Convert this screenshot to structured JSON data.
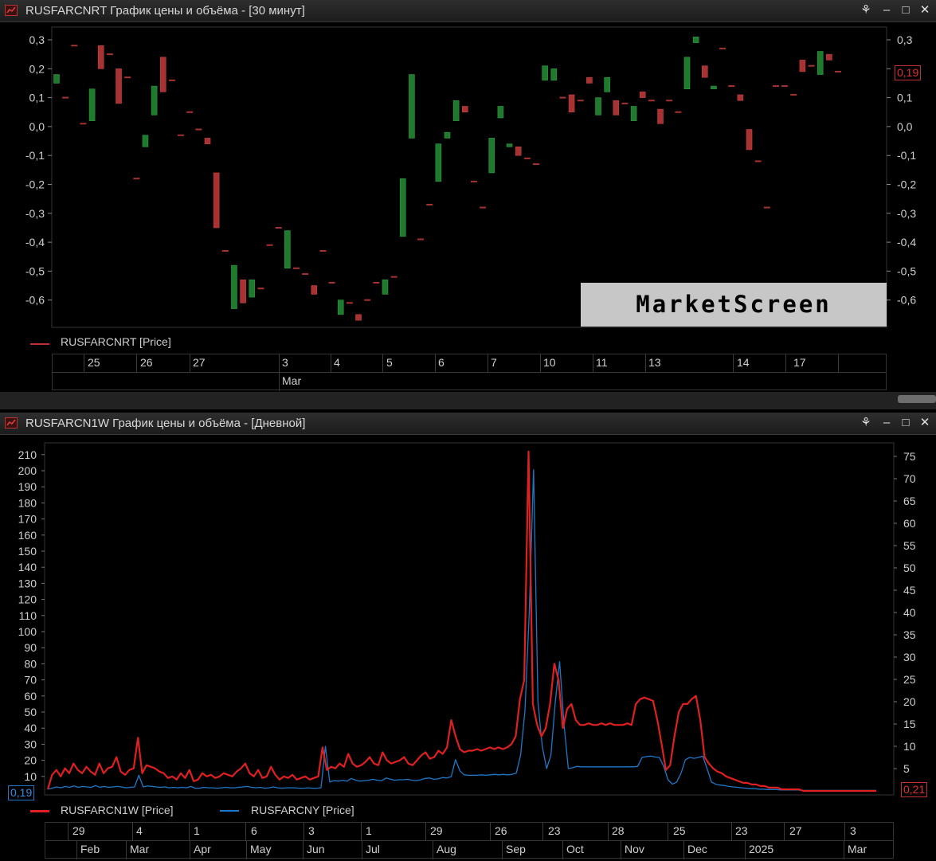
{
  "top_window": {
    "title": "RUSFARCNRT График цены и объёма - [30 минут]",
    "legend": "RUSFARCNRT [Price]",
    "last_value": "0,19",
    "y_ticks": [
      "0,3",
      "0,2",
      "0,1",
      "0,0",
      "-0,1",
      "-0,2",
      "-0,3",
      "-0,4",
      "-0,5",
      "-0,6"
    ],
    "day_labels": [
      "25",
      "26",
      "27",
      "3",
      "4",
      "5",
      "6",
      "7",
      "10",
      "11",
      "13",
      "14",
      "17"
    ],
    "month_labels": [
      "Mar"
    ],
    "watermark": "MarketScreen"
  },
  "bottom_window": {
    "title": "RUSFARCN1W График цены и объёма - [Дневной]",
    "legend_1": "RUSFARCN1W [Price]",
    "legend_2": "RUSFARCNY [Price]",
    "left_value": "0,19",
    "right_value": "0,21",
    "y_ticks_left": [
      "210",
      "200",
      "190",
      "180",
      "170",
      "160",
      "150",
      "140",
      "130",
      "120",
      "110",
      "100",
      "90",
      "80",
      "70",
      "60",
      "50",
      "40",
      "30",
      "20",
      "10"
    ],
    "y_ticks_right": [
      "75",
      "70",
      "65",
      "60",
      "55",
      "50",
      "45",
      "40",
      "35",
      "30",
      "25",
      "20",
      "15",
      "10",
      "5"
    ],
    "day_labels": [
      "29",
      "4",
      "1",
      "6",
      "3",
      "1",
      "29",
      "26",
      "23",
      "28",
      "25",
      "23",
      "27",
      "3"
    ],
    "month_labels": [
      "Feb",
      "Mar",
      "Apr",
      "May",
      "Jun",
      "Jul",
      "Aug",
      "Sep",
      "Oct",
      "Nov",
      "Dec",
      "2025",
      "Mar"
    ]
  },
  "colors": {
    "up": "#1f7a2e",
    "down": "#a83232",
    "red_line": "#e02020",
    "blue_line": "#1e78c8",
    "axis": "#cfcfcf"
  },
  "icons": [
    "chart-app-icon",
    "pin-icon",
    "minimize-icon",
    "maximize-icon",
    "close-icon"
  ],
  "chart_data": [
    {
      "type": "candlestick",
      "series": [
        {
          "name": "RUSFARCNRT [Price]"
        }
      ],
      "ylim": [
        -0.65,
        0.33
      ],
      "candles": [
        {
          "o": 0.15,
          "c": 0.18
        },
        {
          "o": 0.1,
          "c": 0.1
        },
        {
          "o": 0.28,
          "c": 0.28
        },
        {
          "o": 0.01,
          "c": 0.01
        },
        {
          "o": 0.02,
          "c": 0.13
        },
        {
          "o": 0.28,
          "c": 0.2
        },
        {
          "o": 0.25,
          "c": 0.25
        },
        {
          "o": 0.2,
          "c": 0.08
        },
        {
          "o": 0.17,
          "c": 0.17
        },
        {
          "o": -0.18,
          "c": -0.18
        },
        {
          "o": -0.07,
          "c": -0.03
        },
        {
          "o": 0.04,
          "c": 0.14
        },
        {
          "o": 0.24,
          "c": 0.12
        },
        {
          "o": 0.16,
          "c": 0.16
        },
        {
          "o": -0.03,
          "c": -0.03
        },
        {
          "o": 0.05,
          "c": 0.05
        },
        {
          "o": -0.01,
          "c": -0.01
        },
        {
          "o": -0.04,
          "c": -0.06
        },
        {
          "o": -0.16,
          "c": -0.35
        },
        {
          "o": -0.43,
          "c": -0.43
        },
        {
          "o": -0.63,
          "c": -0.48
        },
        {
          "o": -0.53,
          "c": -0.61
        },
        {
          "o": -0.59,
          "c": -0.53
        },
        {
          "o": -0.56,
          "c": -0.56
        },
        {
          "o": -0.41,
          "c": -0.41
        },
        {
          "o": -0.35,
          "c": -0.35
        },
        {
          "o": -0.49,
          "c": -0.36
        },
        {
          "o": -0.49,
          "c": -0.49
        },
        {
          "o": -0.51,
          "c": -0.51
        },
        {
          "o": -0.55,
          "c": -0.58
        },
        {
          "o": -0.43,
          "c": -0.43
        },
        {
          "o": -0.54,
          "c": -0.54
        },
        {
          "o": -0.65,
          "c": -0.6
        },
        {
          "o": -0.61,
          "c": -0.61
        },
        {
          "o": -0.65,
          "c": -0.67
        },
        {
          "o": -0.6,
          "c": -0.6
        },
        {
          "o": -0.54,
          "c": -0.54
        },
        {
          "o": -0.58,
          "c": -0.53
        },
        {
          "o": -0.52,
          "c": -0.52
        },
        {
          "o": -0.38,
          "c": -0.18
        },
        {
          "o": -0.04,
          "c": 0.18
        },
        {
          "o": -0.39,
          "c": -0.39
        },
        {
          "o": -0.27,
          "c": -0.27
        },
        {
          "o": -0.19,
          "c": -0.06
        },
        {
          "o": -0.04,
          "c": -0.02
        },
        {
          "o": 0.02,
          "c": 0.09
        },
        {
          "o": 0.07,
          "c": 0.05
        },
        {
          "o": -0.19,
          "c": -0.19
        },
        {
          "o": -0.28,
          "c": -0.28
        },
        {
          "o": -0.16,
          "c": -0.04
        },
        {
          "o": 0.03,
          "c": 0.07
        },
        {
          "o": -0.07,
          "c": -0.06
        },
        {
          "o": -0.07,
          "c": -0.1
        },
        {
          "o": -0.11,
          "c": -0.11
        },
        {
          "o": -0.13,
          "c": -0.13
        },
        {
          "o": 0.16,
          "c": 0.21
        },
        {
          "o": 0.16,
          "c": 0.2
        },
        {
          "o": 0.1,
          "c": 0.1
        },
        {
          "o": 0.11,
          "c": 0.05
        },
        {
          "o": 0.09,
          "c": 0.09
        },
        {
          "o": 0.17,
          "c": 0.15
        },
        {
          "o": 0.04,
          "c": 0.1
        },
        {
          "o": 0.12,
          "c": 0.17
        },
        {
          "o": 0.09,
          "c": 0.04
        },
        {
          "o": 0.08,
          "c": 0.08
        },
        {
          "o": 0.02,
          "c": 0.07
        },
        {
          "o": 0.12,
          "c": 0.1
        },
        {
          "o": 0.09,
          "c": 0.09
        },
        {
          "o": 0.06,
          "c": 0.01
        },
        {
          "o": 0.09,
          "c": 0.09
        },
        {
          "o": 0.05,
          "c": 0.05
        },
        {
          "o": 0.13,
          "c": 0.24
        },
        {
          "o": 0.29,
          "c": 0.31
        },
        {
          "o": 0.21,
          "c": 0.17
        },
        {
          "o": 0.13,
          "c": 0.14
        },
        {
          "o": 0.27,
          "c": 0.27
        },
        {
          "o": 0.14,
          "c": 0.14
        },
        {
          "o": 0.11,
          "c": 0.09
        },
        {
          "o": -0.01,
          "c": -0.08
        },
        {
          "o": -0.12,
          "c": -0.12
        },
        {
          "o": -0.28,
          "c": -0.28
        },
        {
          "o": 0.14,
          "c": 0.14
        },
        {
          "o": 0.14,
          "c": 0.14
        },
        {
          "o": 0.11,
          "c": 0.11
        },
        {
          "o": 0.23,
          "c": 0.19
        },
        {
          "o": 0.21,
          "c": 0.21
        },
        {
          "o": 0.18,
          "c": 0.26
        },
        {
          "o": 0.25,
          "c": 0.23
        },
        {
          "o": 0.19,
          "c": 0.19
        }
      ]
    },
    {
      "type": "line",
      "series": [
        {
          "name": "RUSFARCN1W [Price]",
          "axis": "left",
          "values": [
            2,
            11,
            14,
            10,
            15,
            12,
            18,
            14,
            12,
            16,
            13,
            11,
            18,
            12,
            15,
            16,
            22,
            13,
            11,
            14,
            15,
            34,
            12,
            17,
            16,
            15,
            13,
            12,
            9,
            10,
            8,
            12,
            9,
            14,
            7,
            8,
            12,
            10,
            11,
            9,
            10,
            12,
            11,
            10,
            13,
            15,
            18,
            12,
            10,
            14,
            9,
            10,
            16,
            11,
            8,
            10,
            9,
            11,
            8,
            9,
            10,
            8,
            9,
            10,
            28,
            14,
            16,
            15,
            18,
            16,
            24,
            18,
            16,
            17,
            19,
            22,
            18,
            17,
            25,
            20,
            18,
            19,
            20,
            22,
            18,
            17,
            20,
            23,
            25,
            21,
            22,
            26,
            24,
            28,
            45,
            35,
            27,
            25,
            26,
            26,
            27,
            26,
            27,
            28,
            27,
            28,
            27,
            28,
            30,
            35,
            58,
            70,
            212,
            55,
            42,
            35,
            40,
            55,
            80,
            70,
            40,
            52,
            55,
            45,
            42,
            42,
            43,
            42,
            42,
            43,
            42,
            43,
            42,
            42,
            42,
            43,
            42,
            55,
            58,
            59,
            58,
            57,
            45,
            30,
            14,
            17,
            35,
            50,
            55,
            55,
            58,
            60,
            45,
            22,
            18,
            15,
            13,
            12,
            10,
            9,
            8,
            7,
            6,
            6,
            5,
            5,
            4,
            4,
            3,
            3,
            3,
            2,
            2,
            2,
            2,
            2,
            1,
            1,
            1,
            1,
            1,
            1,
            1,
            1,
            1,
            1,
            1,
            1,
            1,
            1,
            1,
            1,
            1,
            1
          ]
        },
        {
          "name": "RUSFARCNY [Price]",
          "axis": "right",
          "values": [
            0.4,
            0.6,
            0.9,
            0.7,
            1.0,
            0.8,
            1.1,
            0.8,
            1.0,
            0.9,
            0.8,
            1.2,
            0.8,
            1.0,
            0.8,
            0.9,
            1.0,
            0.9,
            0.7,
            0.8,
            0.9,
            3.5,
            0.9,
            1.1,
            1.0,
            0.9,
            0.8,
            0.9,
            0.7,
            0.8,
            0.7,
            0.8,
            0.7,
            1.0,
            0.6,
            0.6,
            0.8,
            0.7,
            0.7,
            0.6,
            0.7,
            0.8,
            0.7,
            0.7,
            0.8,
            0.9,
            1.0,
            0.8,
            0.7,
            0.8,
            0.6,
            0.7,
            0.9,
            0.7,
            0.6,
            0.7,
            0.7,
            0.7,
            0.6,
            0.6,
            0.7,
            0.6,
            0.6,
            0.7,
            10.0,
            2.0,
            2.3,
            2.2,
            2.4,
            2.2,
            2.8,
            2.4,
            2.2,
            2.3,
            2.4,
            2.6,
            2.4,
            2.3,
            2.9,
            2.6,
            2.4,
            2.5,
            2.5,
            2.6,
            2.4,
            2.3,
            2.5,
            2.8,
            2.9,
            2.6,
            2.7,
            3.0,
            2.9,
            3.2,
            7.0,
            4.5,
            3.6,
            3.5,
            3.5,
            3.5,
            3.6,
            3.5,
            3.6,
            3.7,
            3.6,
            3.7,
            3.6,
            3.7,
            4.0,
            8.0,
            18.0,
            40.0,
            72.0,
            20.0,
            10.0,
            5.0,
            8.0,
            20.0,
            29.0,
            15.0,
            5.0,
            5.2,
            5.5,
            5.4,
            5.4,
            5.4,
            5.4,
            5.4,
            5.4,
            5.4,
            5.4,
            5.4,
            5.4,
            5.4,
            5.4,
            5.4,
            5.5,
            7.5,
            7.7,
            7.8,
            7.6,
            7.5,
            5.5,
            2.5,
            1.5,
            2.0,
            4.0,
            7.0,
            7.5,
            7.3,
            7.5,
            7.8,
            5.0,
            2.0,
            1.5,
            1.3,
            1.2,
            1.0,
            0.9,
            0.8,
            0.7,
            0.6,
            0.5,
            0.5,
            0.4,
            0.4,
            0.3,
            0.3,
            0.3,
            0.2,
            0.2,
            0.2,
            0.2,
            0.2,
            0.1,
            0.1,
            0.1,
            0.1,
            0.1,
            0.1,
            0.1,
            0.1,
            0.1,
            0.1,
            0.1,
            0.1,
            0.1,
            0.1,
            0.1,
            0.1,
            0.1,
            0.1
          ]
        }
      ]
    }
  ]
}
